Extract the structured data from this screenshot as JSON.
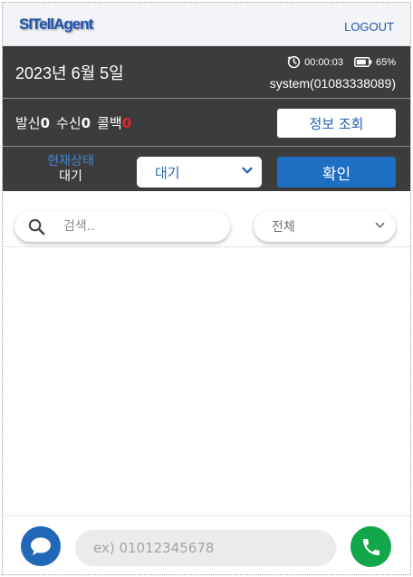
{
  "header": {
    "logo": "SITellAgent",
    "logout_label": "LOGOUT"
  },
  "info": {
    "date": "2023년 6월 5일",
    "timer": "00:00:03",
    "battery": "65%",
    "user": "system(01083338089)"
  },
  "counts": {
    "outgoing_label": "발신",
    "outgoing_value": "0",
    "incoming_label": "수신",
    "incoming_value": "0",
    "callback_label": "콜백",
    "callback_value": "0"
  },
  "actions": {
    "info_lookup_label": "정보 조회",
    "confirm_label": "확인"
  },
  "status": {
    "label": "현재상태",
    "current": "대기",
    "selected": "대기"
  },
  "search": {
    "placeholder": "검색..",
    "filter_selected": "전체"
  },
  "dialer": {
    "placeholder": "ex) 01012345678"
  },
  "colors": {
    "accent": "#1d6fc3",
    "dark_panel": "#3c3c3c",
    "callback_count": "#e8222f",
    "call_button": "#11a74a"
  },
  "icons": {
    "search": "search-icon",
    "timer": "clock-icon",
    "battery": "battery-icon",
    "dropdown": "chevron-down-icon",
    "chat": "chat-bubble-icon",
    "call": "phone-icon"
  }
}
